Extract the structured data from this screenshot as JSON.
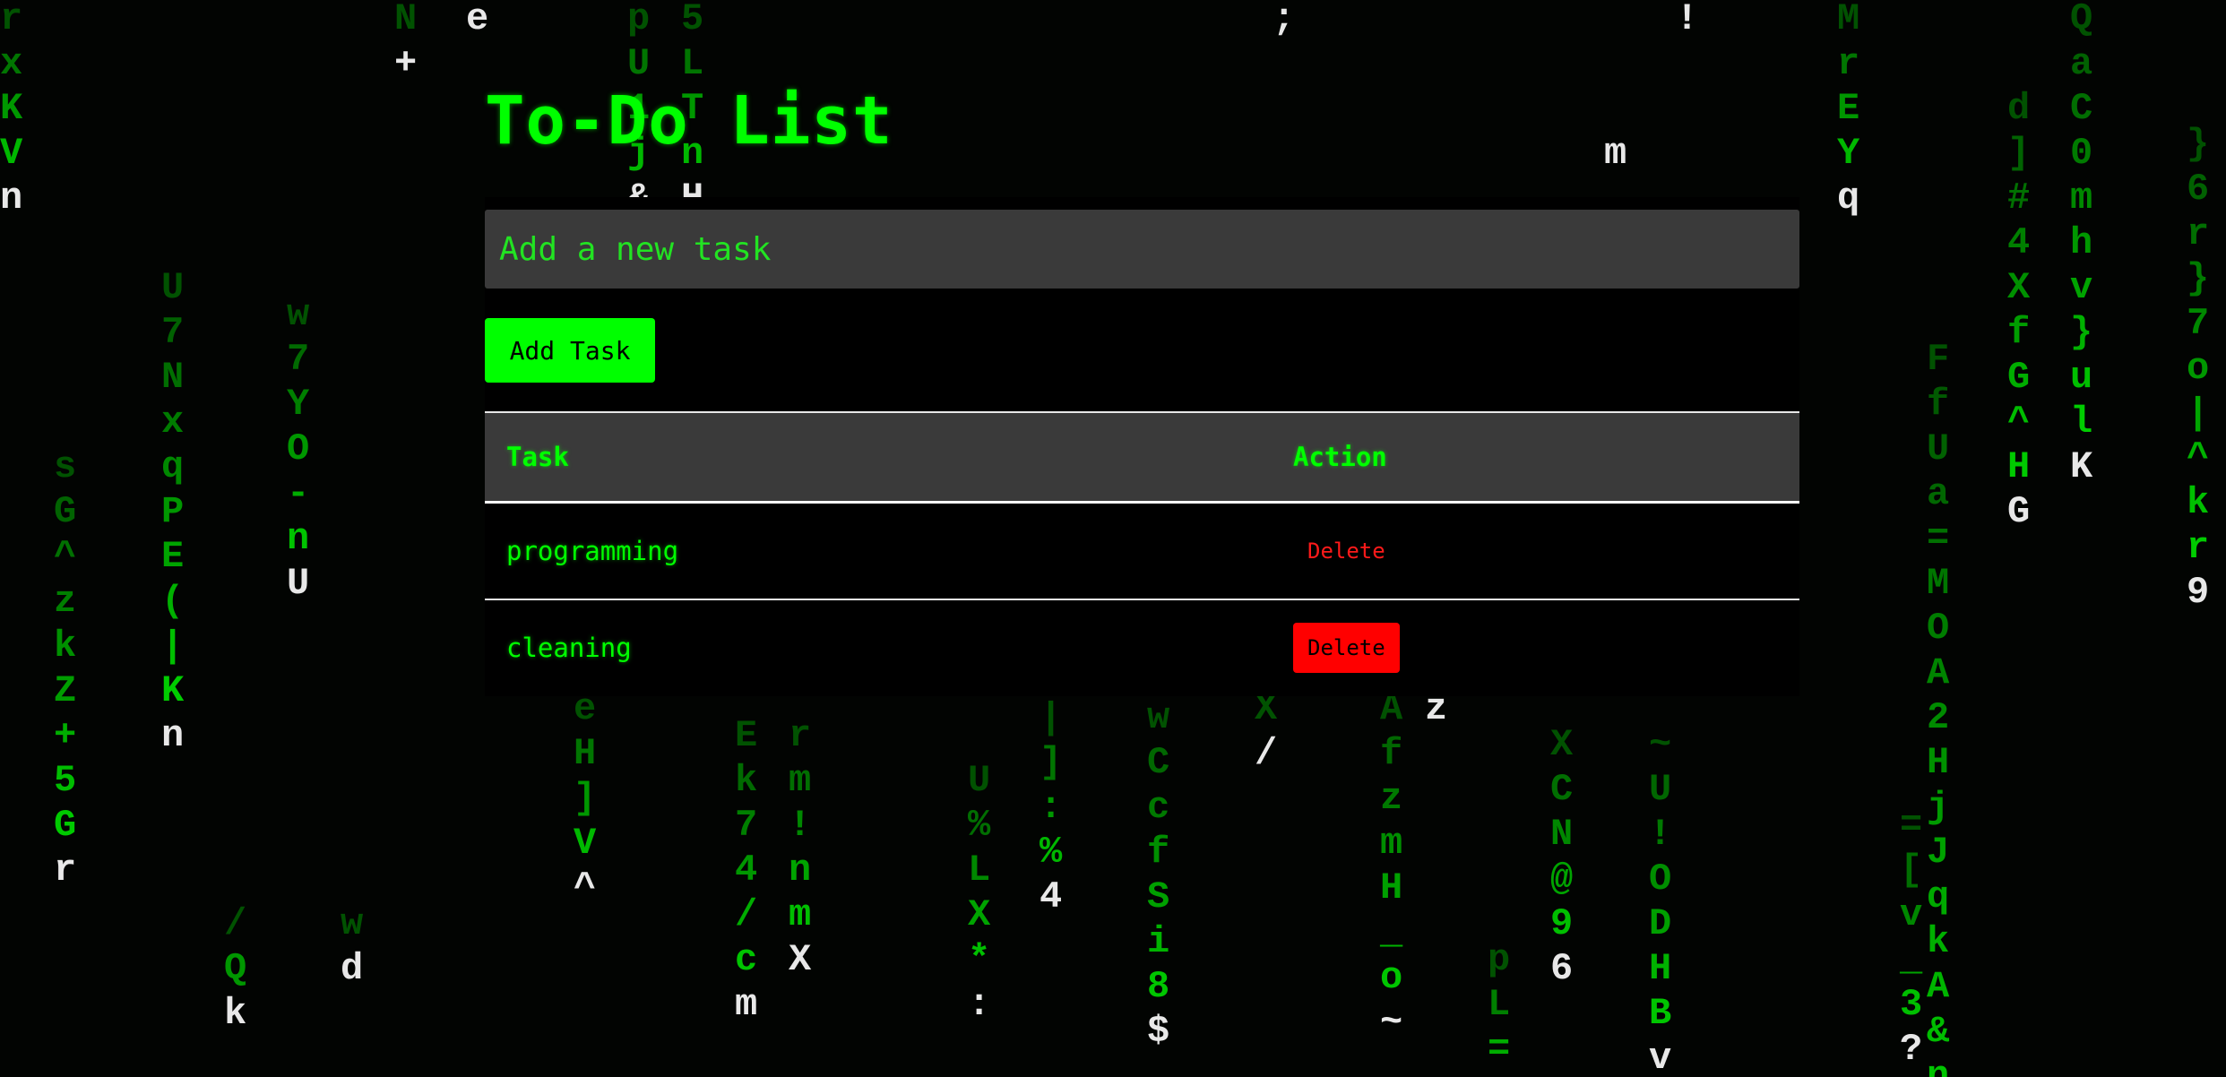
{
  "app": {
    "title": "To-Do List",
    "input": {
      "placeholder": "Add a new task",
      "value": ""
    },
    "add_button_label": "Add Task",
    "table": {
      "headers": {
        "task": "Task",
        "action": "Action"
      },
      "rows": [
        {
          "task": "programming",
          "action_label": "Delete",
          "hovered": false
        },
        {
          "task": "cleaning",
          "action_label": "Delete",
          "hovered": true
        }
      ]
    }
  },
  "colors": {
    "background": "#020402",
    "accent_green": "#00ff00",
    "input_background": "#3a3a3a",
    "delete_red": "#ff0000"
  },
  "background_effect": "matrix-digital-rain"
}
